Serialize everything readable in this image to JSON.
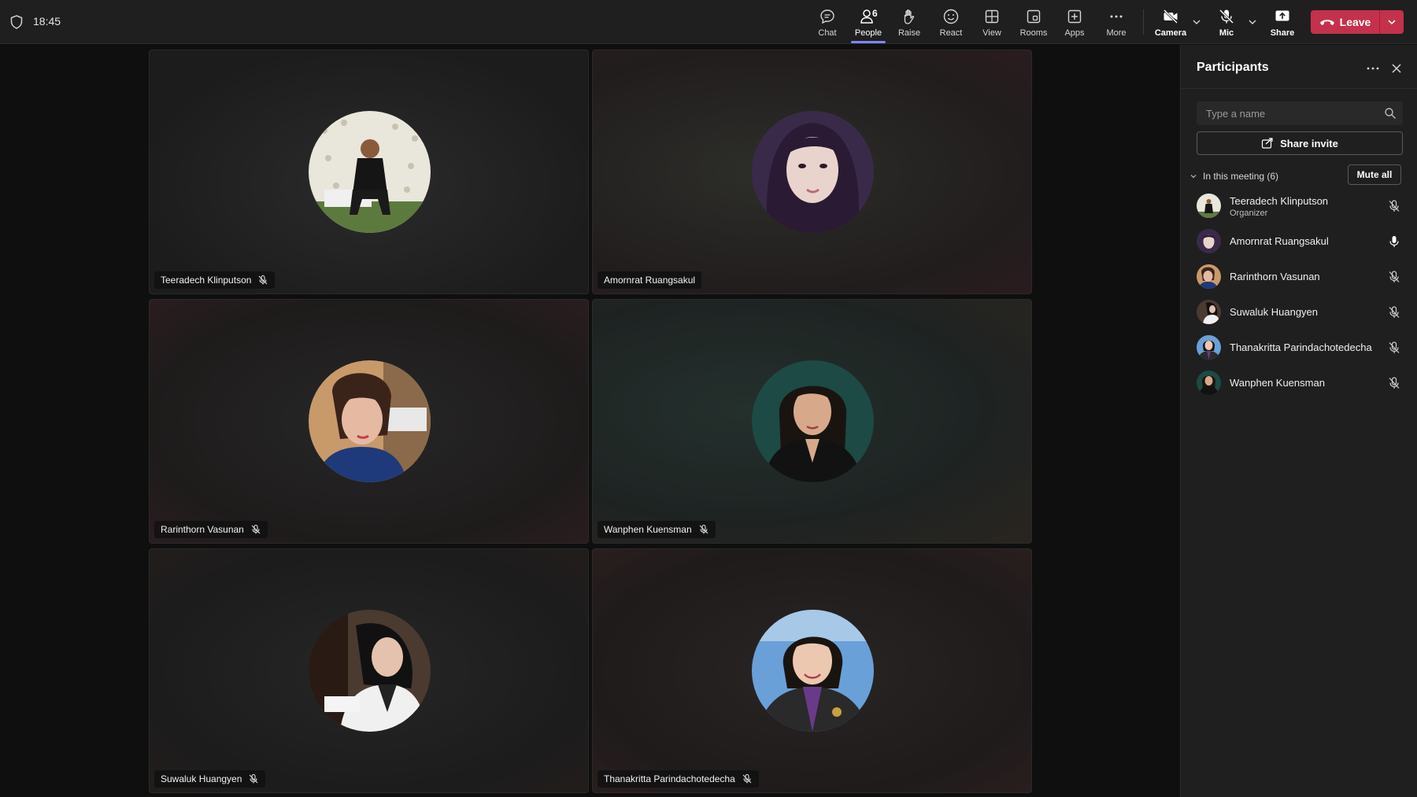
{
  "status": {
    "time": "18:45"
  },
  "toolbar": {
    "chat": "Chat",
    "people": "People",
    "people_count": "6",
    "raise": "Raise",
    "react": "React",
    "view": "View",
    "rooms": "Rooms",
    "apps": "Apps",
    "more": "More",
    "camera": "Camera",
    "mic": "Mic",
    "share": "Share",
    "leave": "Leave"
  },
  "tiles": [
    {
      "name": "Teeradech Klinputson",
      "muted": true
    },
    {
      "name": "Amornrat Ruangsakul",
      "muted": false
    },
    {
      "name": "Rarinthorn Vasunan",
      "muted": true
    },
    {
      "name": "Wanphen Kuensman",
      "muted": true
    },
    {
      "name": "Suwaluk Huangyen",
      "muted": true
    },
    {
      "name": "Thanakritta Parindachotedecha",
      "muted": true
    }
  ],
  "panel": {
    "title": "Participants",
    "search_placeholder": "Type a name",
    "share_invite": "Share invite",
    "section_label": "In this meeting (6)",
    "mute_all": "Mute all",
    "participants": [
      {
        "name": "Teeradech Klinputson",
        "role": "Organizer",
        "muted": true
      },
      {
        "name": "Amornrat Ruangsakul",
        "role": "",
        "muted": false
      },
      {
        "name": "Rarinthorn Vasunan",
        "role": "",
        "muted": true
      },
      {
        "name": "Suwaluk Huangyen",
        "role": "",
        "muted": true
      },
      {
        "name": "Thanakritta Parindachotedecha",
        "role": "",
        "muted": true
      },
      {
        "name": "Wanphen Kuensman",
        "role": "",
        "muted": true
      }
    ]
  },
  "colors": {
    "accent": "#7f85f5",
    "leave": "#c4314b",
    "topbar": "#1f1f1f",
    "panel": "#1f1f1f",
    "stage": "#0f0f0f"
  }
}
